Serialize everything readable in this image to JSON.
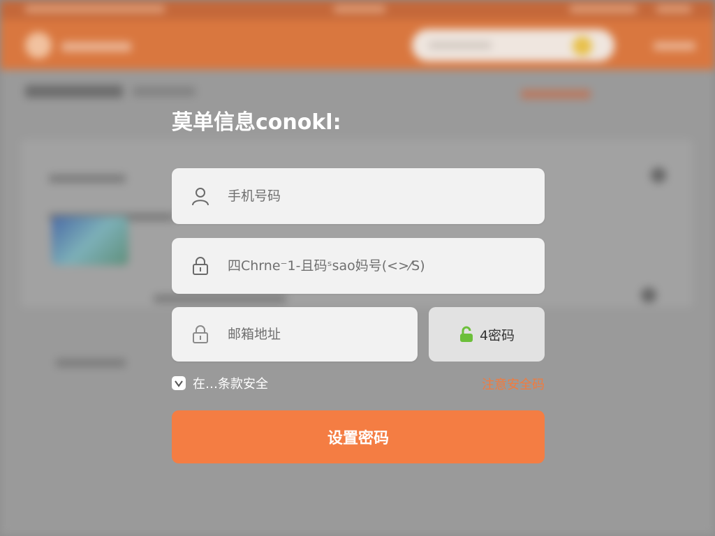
{
  "form": {
    "title": "莫单信息conokl:",
    "phone_placeholder": "手机号码",
    "password_placeholder": "四Chrne⁻1-且码ˢsao妈号(<>⁄S)",
    "email_placeholder": "邮箱地址",
    "code_button_label": "4密码",
    "agree_text": "在…条款安全",
    "link_text": "注意安全码",
    "submit_label": "设置密码"
  },
  "icons": {
    "phone": "user-icon",
    "password": "lock-icon",
    "email": "lock-icon",
    "code": "green-lock-icon",
    "checkbox": "check-icon"
  },
  "colors": {
    "accent": "#f47d43",
    "link": "#f07b3f",
    "header": "#d9773f",
    "code_icon": "#6cbf3a"
  }
}
